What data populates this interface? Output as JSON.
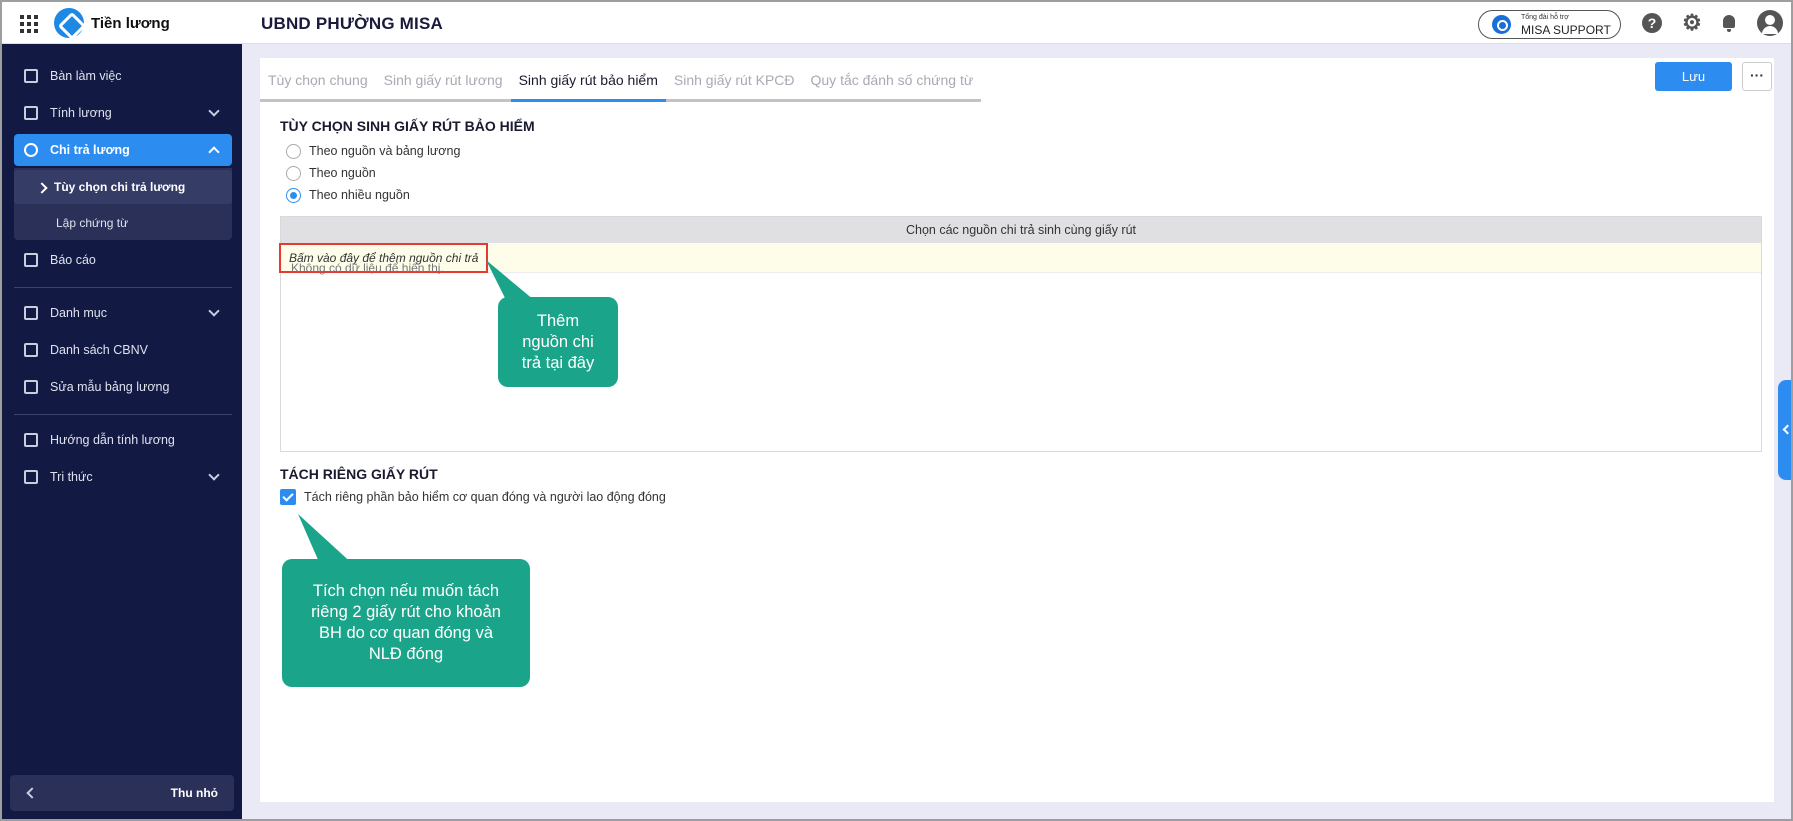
{
  "app": {
    "name": "Tiền lương",
    "organization": "UBND PHƯỜNG MISA"
  },
  "support": {
    "small_label": "Tổng đài hỗ trợ",
    "label": "MISA SUPPORT"
  },
  "header_icons": [
    "help-icon",
    "gear-icon",
    "bell-icon",
    "avatar-icon"
  ],
  "sidebar": {
    "items": [
      {
        "label": "Bàn làm việc",
        "icon": "dashboard-icon"
      },
      {
        "label": "Tính lương",
        "icon": "wallet-icon",
        "expandable": true
      },
      {
        "label": "Chi trả lương",
        "icon": "hand-money-icon",
        "expandable": true,
        "active": true
      },
      {
        "label": "Báo cáo",
        "icon": "report-icon"
      },
      {
        "label": "Danh mục",
        "icon": "list-icon",
        "expandable": true
      },
      {
        "label": "Danh sách CBNV",
        "icon": "employee-icon"
      },
      {
        "label": "Sửa mẫu bảng lương",
        "icon": "template-icon"
      },
      {
        "label": "Hướng dẫn tính lương",
        "icon": "guide-icon"
      },
      {
        "label": "Tri thức",
        "icon": "knowledge-icon",
        "expandable": true
      }
    ],
    "sub_items": [
      {
        "label": "Tùy chọn chi trả lương",
        "active": true
      },
      {
        "label": "Lập chứng từ"
      }
    ],
    "collapse_label": "Thu nhỏ"
  },
  "tabs": [
    {
      "label": "Tùy chọn chung"
    },
    {
      "label": "Sinh giấy rút lương"
    },
    {
      "label": "Sinh giấy rút bảo hiểm",
      "active": true
    },
    {
      "label": "Sinh giấy rút KPCĐ"
    },
    {
      "label": "Quy tắc đánh số chứng từ"
    }
  ],
  "actions": {
    "save_label": "Lưu",
    "more_label": "···"
  },
  "insurance_section": {
    "title": "TÙY CHỌN SINH GIẤY RÚT BẢO HIỂM",
    "options": [
      {
        "label": "Theo nguồn và bảng lương",
        "checked": false
      },
      {
        "label": "Theo nguồn",
        "checked": false
      },
      {
        "label": "Theo nhiều nguồn",
        "checked": true
      }
    ]
  },
  "source_grid": {
    "header": "Chọn các nguồn chi trả sinh cùng giấy rút",
    "add_link": "Bấm vào đây để thêm nguồn chi trả",
    "empty_text": "Không có dữ liệu để hiển thị."
  },
  "separate_section": {
    "title": "TÁCH RIÊNG GIẤY RÚT",
    "checkbox_label": "Tách riêng phần bảo hiểm cơ quan đóng và người lao động đóng",
    "checked": true
  },
  "callouts": {
    "add_source": "Thêm nguồn chi trả tại đây",
    "separate": "Tích chọn nếu muốn tách riêng 2 giấy rút cho khoản BH do cơ quan đóng và NLĐ đóng"
  },
  "colors": {
    "accent": "#2d8cf0",
    "sidebar_bg": "#121943",
    "callout": "#1aa58a",
    "highlight_border": "#e53935"
  }
}
